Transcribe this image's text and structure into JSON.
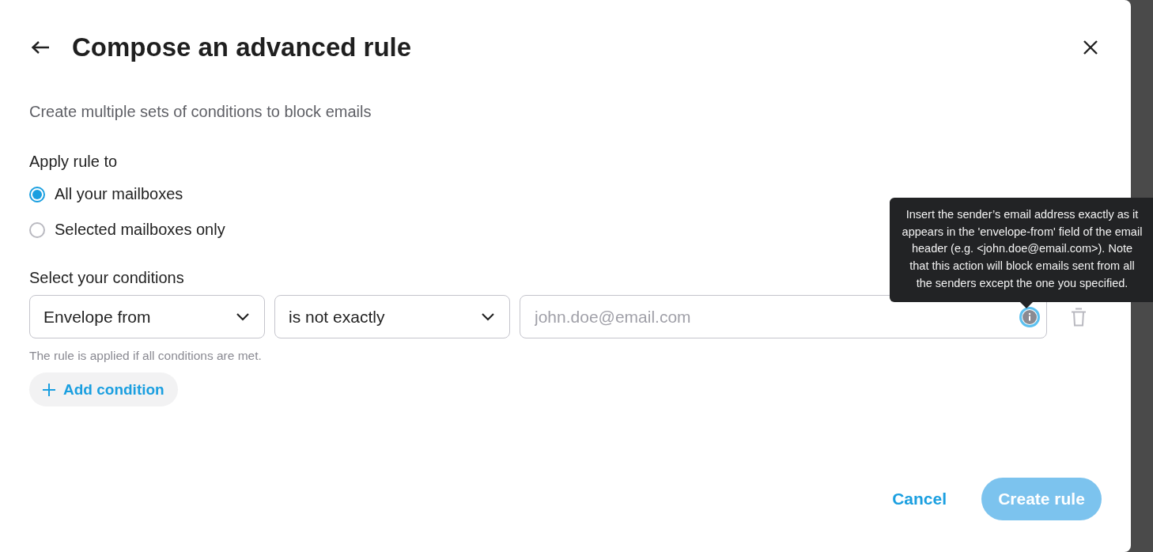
{
  "dialog": {
    "title": "Compose an advanced rule",
    "subtitle": "Create multiple sets of conditions to block emails"
  },
  "apply_rule": {
    "label": "Apply rule to",
    "options": [
      {
        "label": "All your mailboxes",
        "selected": true
      },
      {
        "label": "Selected mailboxes only",
        "selected": false
      }
    ]
  },
  "conditions": {
    "label": "Select your conditions",
    "rows": [
      {
        "field": "Envelope from",
        "operator": "is not exactly",
        "value_placeholder": "john.doe@email.com"
      }
    ],
    "hint": "The rule is applied if all conditions are met.",
    "add_button": "Add condition"
  },
  "tooltip": "Insert the sender’s email address exactly as it appears in the 'envelope-from' field of the email header (e.g. <john.doe@email.com>). Note that this action will block emails sent from all the senders except the one you specified.",
  "footer": {
    "cancel": "Cancel",
    "create": {
      "label": "Create rule",
      "disabled": true
    }
  }
}
